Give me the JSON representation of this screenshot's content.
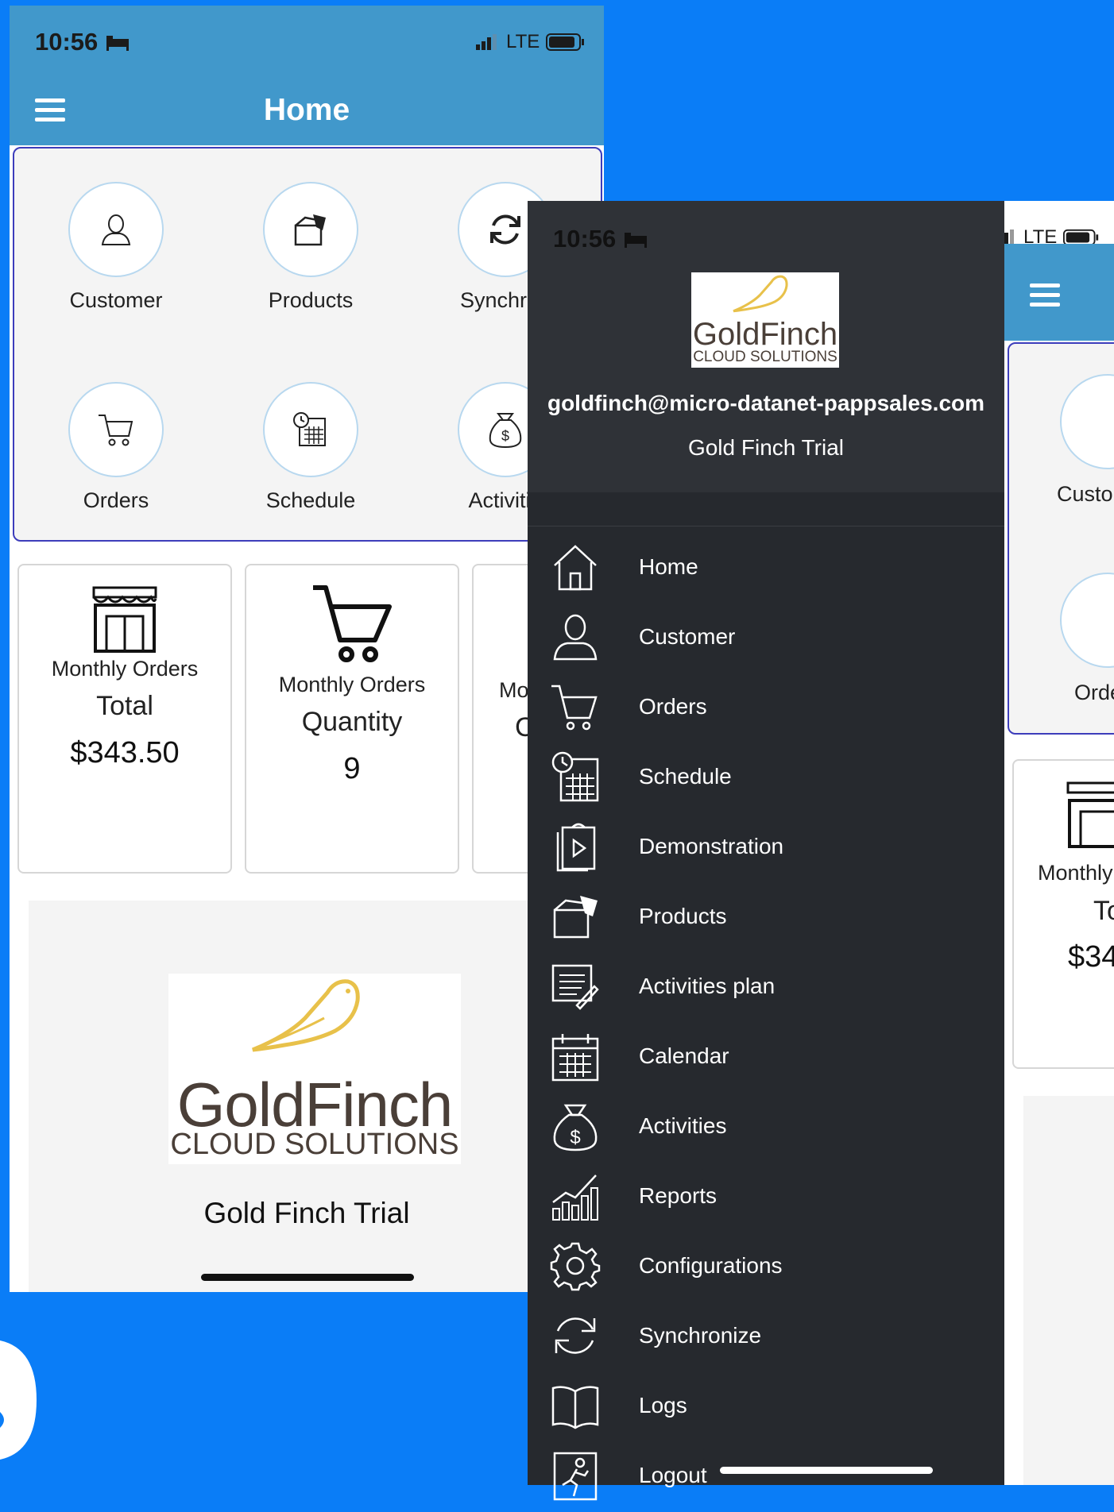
{
  "status": {
    "time": "10:56",
    "network": "LTE"
  },
  "home": {
    "title": "Home",
    "tiles": [
      {
        "label": "Customer",
        "icon": "customer-icon"
      },
      {
        "label": "Products",
        "icon": "products-icon"
      },
      {
        "label": "Synchron",
        "icon": "sync-icon"
      },
      {
        "label": "Orders",
        "icon": "cart-icon"
      },
      {
        "label": "Schedule",
        "icon": "schedule-icon"
      },
      {
        "label": "Activitie",
        "icon": "money-bag-icon"
      }
    ],
    "stats": [
      {
        "title": "Monthly Orders",
        "sub": "Total",
        "value": "$343.50"
      },
      {
        "title": "Monthly Orders",
        "sub": "Quantity",
        "value": "9"
      },
      {
        "title": "Mo",
        "sub": "C",
        "value": ""
      }
    ],
    "logo_main": "GoldFinch",
    "logo_sub": "CLOUD SOLUTIONS",
    "org_name": "Gold Finch Trial"
  },
  "drawer": {
    "email": "goldfinch@micro-datanet-pappsales.com",
    "org": "Gold Finch Trial",
    "logo_main": "GoldFinch",
    "logo_sub": "CLOUD SOLUTIONS",
    "items": [
      {
        "label": "Home",
        "icon": "home-icon"
      },
      {
        "label": "Customer",
        "icon": "customer-icon"
      },
      {
        "label": "Orders",
        "icon": "cart-icon"
      },
      {
        "label": "Schedule",
        "icon": "schedule-icon"
      },
      {
        "label": "Demonstration",
        "icon": "demonstration-icon"
      },
      {
        "label": "Products",
        "icon": "products-icon"
      },
      {
        "label": "Activities plan",
        "icon": "activities-plan-icon"
      },
      {
        "label": "Calendar",
        "icon": "calendar-icon"
      },
      {
        "label": "Activities",
        "icon": "money-bag-icon"
      },
      {
        "label": "Reports",
        "icon": "reports-icon"
      },
      {
        "label": "Configurations",
        "icon": "gear-icon"
      },
      {
        "label": "Synchronize",
        "icon": "sync-icon"
      },
      {
        "label": "Logs",
        "icon": "book-icon"
      },
      {
        "label": "Logout",
        "icon": "logout-icon"
      }
    ]
  },
  "right_phone": {
    "tiles": [
      "Custo",
      "Orde"
    ],
    "stat_title": "Monthly",
    "stat_sub": "To",
    "stat_value": "$34"
  },
  "colors": {
    "background": "#0a7df7",
    "appbar": "#4198cb",
    "drawer": "#26292e",
    "accent_border": "#3d3dbb"
  }
}
